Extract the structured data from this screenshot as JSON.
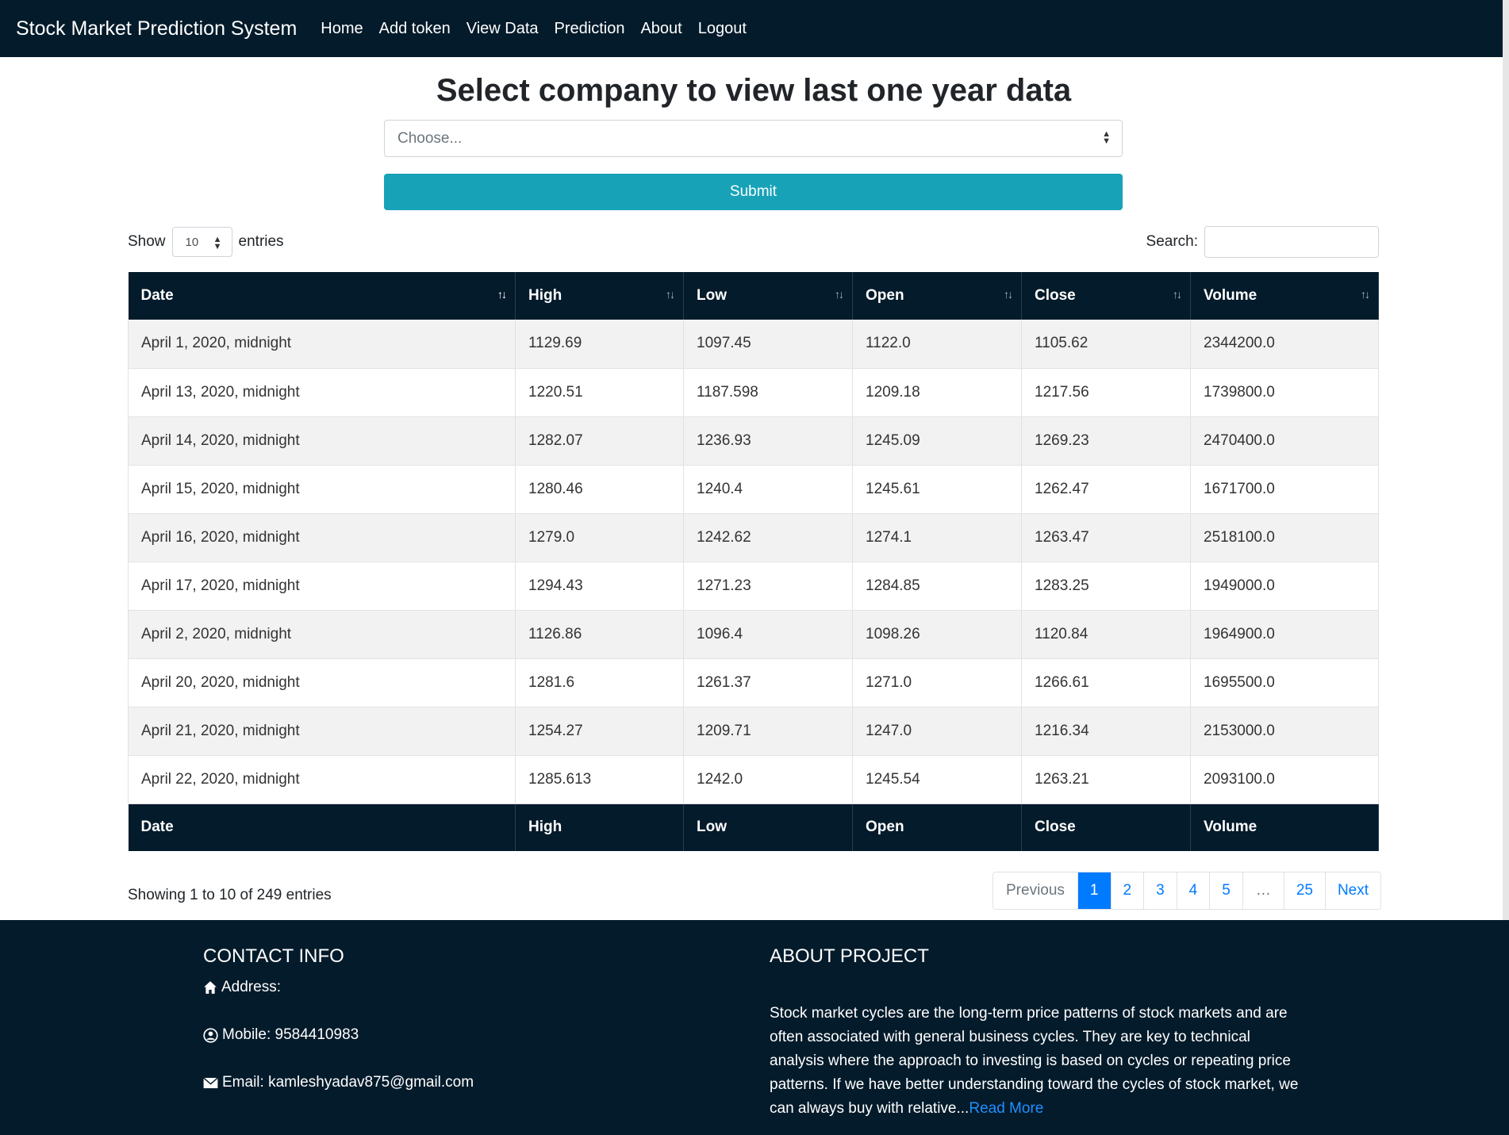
{
  "navbar": {
    "brand": "Stock Market Prediction System",
    "links": [
      "Home",
      "Add token",
      "View Data",
      "Prediction",
      "About",
      "Logout"
    ]
  },
  "form": {
    "title": "Select company to view last one year data",
    "select_placeholder": "Choose...",
    "submit_label": "Submit"
  },
  "table_controls": {
    "show_label": "Show",
    "entries_value": "10",
    "entries_label": "entries",
    "search_label": "Search:"
  },
  "table": {
    "columns": [
      "Date",
      "High",
      "Low",
      "Open",
      "Close",
      "Volume"
    ],
    "rows": [
      [
        "April 1, 2020, midnight",
        "1129.69",
        "1097.45",
        "1122.0",
        "1105.62",
        "2344200.0"
      ],
      [
        "April 13, 2020, midnight",
        "1220.51",
        "1187.598",
        "1209.18",
        "1217.56",
        "1739800.0"
      ],
      [
        "April 14, 2020, midnight",
        "1282.07",
        "1236.93",
        "1245.09",
        "1269.23",
        "2470400.0"
      ],
      [
        "April 15, 2020, midnight",
        "1280.46",
        "1240.4",
        "1245.61",
        "1262.47",
        "1671700.0"
      ],
      [
        "April 16, 2020, midnight",
        "1279.0",
        "1242.62",
        "1274.1",
        "1263.47",
        "2518100.0"
      ],
      [
        "April 17, 2020, midnight",
        "1294.43",
        "1271.23",
        "1284.85",
        "1283.25",
        "1949000.0"
      ],
      [
        "April 2, 2020, midnight",
        "1126.86",
        "1096.4",
        "1098.26",
        "1120.84",
        "1964900.0"
      ],
      [
        "April 20, 2020, midnight",
        "1281.6",
        "1261.37",
        "1271.0",
        "1266.61",
        "1695500.0"
      ],
      [
        "April 21, 2020, midnight",
        "1254.27",
        "1209.71",
        "1247.0",
        "1216.34",
        "2153000.0"
      ],
      [
        "April 22, 2020, midnight",
        "1285.613",
        "1242.0",
        "1245.54",
        "1263.21",
        "2093100.0"
      ]
    ],
    "info": "Showing 1 to 10 of 249 entries"
  },
  "pagination": {
    "previous": "Previous",
    "pages": [
      "1",
      "2",
      "3",
      "4",
      "5",
      "…",
      "25"
    ],
    "next": "Next",
    "active": "1"
  },
  "footer": {
    "contact_title": "CONTACT INFO",
    "address": "Address:",
    "mobile": "Mobile: 9584410983",
    "email": "Email: kamleshyadav875@gmail.com",
    "about_title": "ABOUT PROJECT",
    "about_text": "Stock market cycles are the long-term price patterns of stock markets and are often associated with general business cycles. They are key to technical analysis where the approach to investing is based on cycles or repeating price patterns. If we have better understanding toward the cycles of stock market, we can always buy with relative...",
    "read_more": "Read More"
  },
  "colors": {
    "navbar_bg": "#041b2b",
    "submit_bg": "#17a2b8",
    "pagination_active": "#007bff"
  }
}
